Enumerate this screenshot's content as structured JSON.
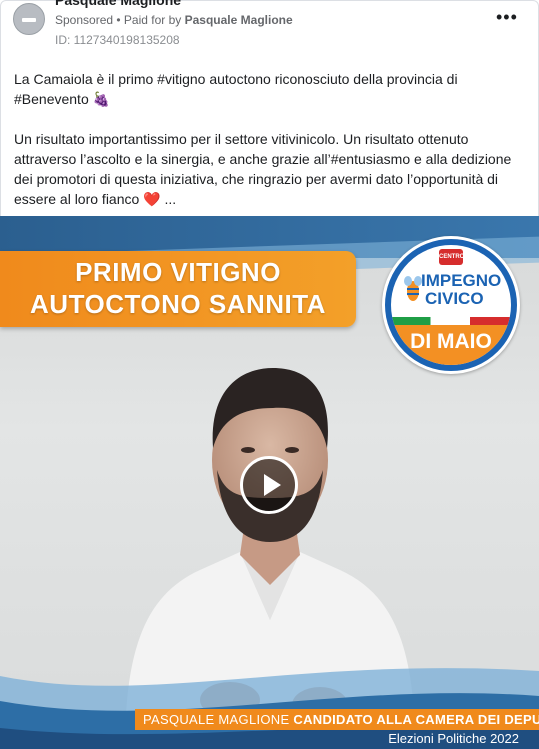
{
  "header": {
    "page_name": "Pasquale Maglione",
    "sponsored": "Sponsored",
    "separator": " • ",
    "paid_for_by": "Paid for by ",
    "advertiser": "Pasquale Maglione",
    "ad_id": "ID: 1127340198135208",
    "more_icon": "more-dots-icon"
  },
  "post": {
    "paragraph1": "La Camaiola è il primo #vitigno autoctono riconosciuto della provincia di #Benevento 🍇",
    "paragraph2": "Un risultato importantissimo per il settore vitivinicolo. Un risultato ottenuto attraverso l’ascolto e la sinergia, e anche grazie all’#entusiasmo e alla dedizione dei promotori di questa iniziativa, che ringrazio per avermi dato l’opportunità di essere al loro fianco",
    "heart": "❤️",
    "ellipsis": " ..."
  },
  "video": {
    "headline_line1": "PRIMO VITIGNO",
    "headline_line2": "AUTOCTONO SANNITA",
    "logo_top": "CENTRO",
    "logo_line1": "IMPEGNO",
    "logo_line2": "CIVICO",
    "logo_bottom": "DI MAIO",
    "name": "PASQUALE MAGLIONE",
    "role": "CANDIDATO ALLA CAMERA DEI DEPUTATI",
    "election": "Elezioni Politiche 2022",
    "play_icon": "play-icon"
  },
  "colors": {
    "orange": "#f08a1c",
    "blue": "#1b63b3",
    "meta_gray": "#65676b"
  }
}
